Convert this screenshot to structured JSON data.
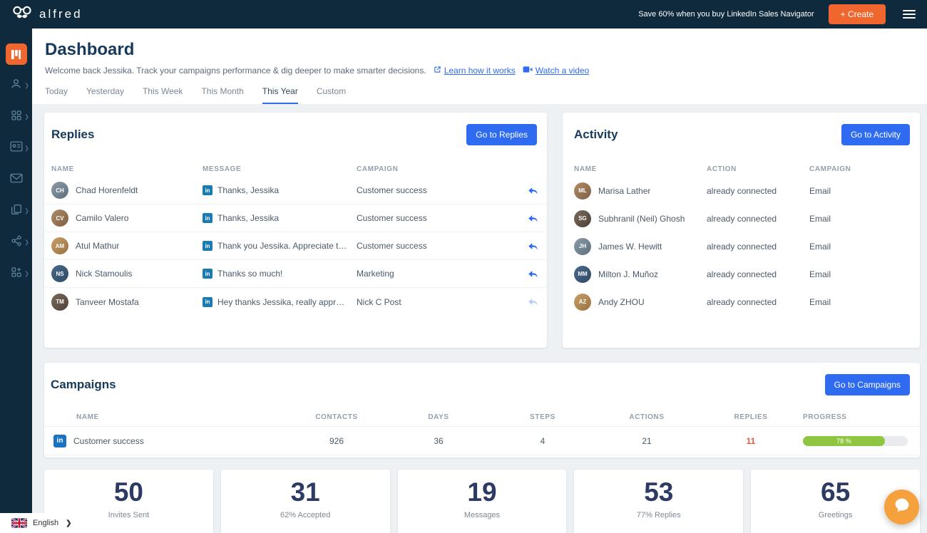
{
  "topbar": {
    "brand": "alfred",
    "promo": "Save 60% when you buy LinkedIn Sales Navigator",
    "create_label": "+ Create"
  },
  "sidebar": {
    "language": "English"
  },
  "page": {
    "title": "Dashboard",
    "subtitle": "Welcome back Jessika. Track your campaigns performance & dig deeper to make smarter decisions.",
    "learn_link": "Learn how it works",
    "watch_link": "Watch a video"
  },
  "tabs": {
    "active": "This Year",
    "items": [
      {
        "label": "Today"
      },
      {
        "label": "Yesterday"
      },
      {
        "label": "This Week"
      },
      {
        "label": "This Month"
      },
      {
        "label": "This Year"
      },
      {
        "label": "Custom"
      }
    ]
  },
  "replies": {
    "title": "Replies",
    "button_label": "Go to Replies",
    "columns": {
      "name": "NAME",
      "message": "MESSAGE",
      "campaign": "CAMPAIGN"
    },
    "rows": [
      {
        "name": "Chad Horenfeldt",
        "message": "Thanks, Jessika",
        "campaign": "Customer success"
      },
      {
        "name": "Camilo Valero",
        "message": "Thanks, Jessika",
        "campaign": "Customer success"
      },
      {
        "name": "Atul Mathur",
        "message": "Thank you Jessika. Appreciate the w...",
        "campaign": "Customer success"
      },
      {
        "name": "Nick Stamoulis",
        "message": "Thanks so much!",
        "campaign": "Marketing"
      },
      {
        "name": "Tanveer Mostafa",
        "message": "Hey thanks Jessika, really appreciat...",
        "campaign": "Nick C Post"
      }
    ]
  },
  "activity": {
    "title": "Activity",
    "button_label": "Go to Activity",
    "columns": {
      "name": "NAME",
      "action": "ACTION",
      "campaign": "CAMPAIGN"
    },
    "rows": [
      {
        "name": "Marisa Lather",
        "action": "already connected",
        "campaign": "Email"
      },
      {
        "name": "Subhranil (Neil) Ghosh",
        "action": "already connected",
        "campaign": "Email"
      },
      {
        "name": "James W. Hewitt",
        "action": "already connected",
        "campaign": "Email"
      },
      {
        "name": "Milton J. Muñoz",
        "action": "already connected",
        "campaign": "Email"
      },
      {
        "name": "Andy ZHOU",
        "action": "already connected",
        "campaign": "Email"
      }
    ]
  },
  "campaigns": {
    "title": "Campaigns",
    "button_label": "Go to Campaigns",
    "columns": {
      "name": "NAME",
      "contacts": "CONTACTS",
      "days": "DAYS",
      "steps": "STEPS",
      "actions": "ACTIONS",
      "replies": "REPLIES",
      "progress": "PROGRESS"
    },
    "rows": [
      {
        "name": "Customer success",
        "contacts": "926",
        "days": "36",
        "steps": "4",
        "actions": "21",
        "replies": "11",
        "progress_label": "78 %",
        "progress_pct": 78
      }
    ]
  },
  "stats": [
    {
      "value": "50",
      "label": "Invites Sent"
    },
    {
      "value": "31",
      "label": "62% Accepted"
    },
    {
      "value": "19",
      "label": "Messages"
    },
    {
      "value": "53",
      "label": "77% Replies"
    },
    {
      "value": "65",
      "label": "Greetings"
    }
  ],
  "colors": {
    "navbar_navy": "#0e2a3c",
    "brand_orange": "#f0662f",
    "primary_blue": "#2e6bf0",
    "progress_green": "#8ec641",
    "replies_count_red": "#e25b40",
    "linkedin_blue": "#1a7ab2"
  }
}
